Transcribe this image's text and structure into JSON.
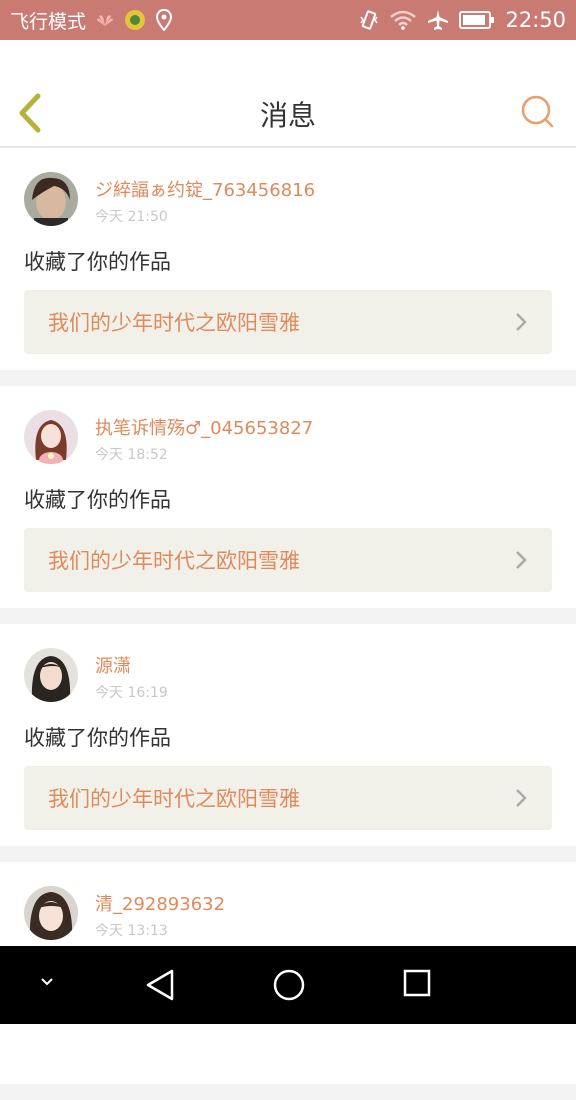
{
  "status_bar": {
    "mode_text": "飞行模式",
    "time": "22:50",
    "icons": [
      "huawei-icon",
      "app-icon",
      "location-icon",
      "vibrate-icon",
      "wifi-icon",
      "airplane-icon",
      "battery-icon"
    ]
  },
  "nav": {
    "title": "消息",
    "back_icon": "chevron-left-icon",
    "search_icon": "search-icon"
  },
  "messages": [
    {
      "user": "ジ綷諨ぁ约锭_763456816",
      "time": "今天 21:50",
      "action": "收藏了你的作品",
      "work": "我们的少年时代之欧阳雪雅"
    },
    {
      "user": "执笔诉情殇♂_045653827",
      "time": "今天 18:52",
      "action": "收藏了你的作品",
      "work": "我们的少年时代之欧阳雪雅"
    },
    {
      "user": "源潇",
      "time": "今天 16:19",
      "action": "收藏了你的作品",
      "work": "我们的少年时代之欧阳雪雅"
    },
    {
      "user": "清_292893632",
      "time": "今天 13:13",
      "action": "",
      "work": ""
    }
  ],
  "colors": {
    "accent": "#e08a5c",
    "status_bar": "#c97b73",
    "back_arrow": "#b9b23a"
  }
}
